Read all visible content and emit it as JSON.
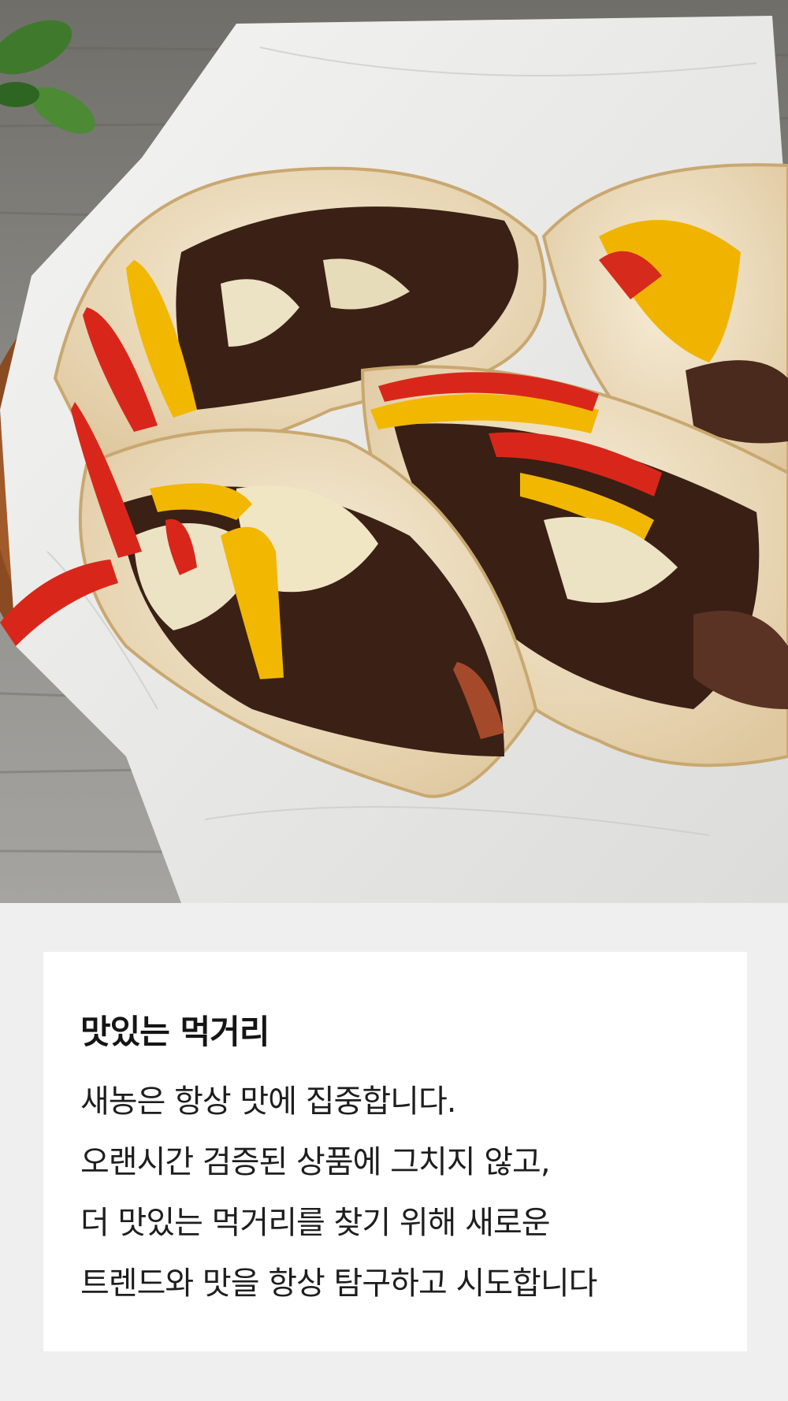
{
  "hero": {
    "subject": "beef bulgogi tortilla wraps with bell peppers and melted cheese on parchment paper"
  },
  "card": {
    "title": "맛있는 먹거리",
    "lines": [
      "새농은 항상 맛에 집중합니다.",
      "오랜시간 검증된 상품에 그치지 않고,",
      "더 맛있는 먹거리를 찾기 위해 새로운",
      "트렌드와 맛을 항상 탐구하고 시도합니다"
    ]
  },
  "colors": {
    "page_background": "#efefef",
    "card_background": "#ffffff",
    "text": "#1e1e1e"
  }
}
